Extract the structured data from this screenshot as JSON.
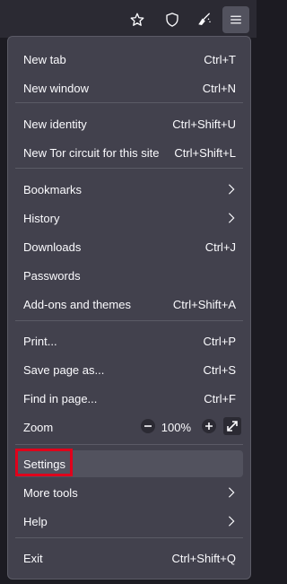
{
  "toolbar": {
    "icons": [
      "star-icon",
      "shield-icon",
      "broom-icon",
      "hamburger-menu-icon"
    ]
  },
  "menu": {
    "new_tab": {
      "label": "New tab",
      "shortcut": "Ctrl+T"
    },
    "new_window": {
      "label": "New window",
      "shortcut": "Ctrl+N"
    },
    "new_identity": {
      "label": "New identity",
      "shortcut": "Ctrl+Shift+U"
    },
    "new_tor_circuit": {
      "label": "New Tor circuit for this site",
      "shortcut": "Ctrl+Shift+L"
    },
    "bookmarks": {
      "label": "Bookmarks"
    },
    "history": {
      "label": "History"
    },
    "downloads": {
      "label": "Downloads",
      "shortcut": "Ctrl+J"
    },
    "passwords": {
      "label": "Passwords"
    },
    "addons": {
      "label": "Add-ons and themes",
      "shortcut": "Ctrl+Shift+A"
    },
    "print": {
      "label": "Print...",
      "shortcut": "Ctrl+P"
    },
    "save_page": {
      "label": "Save page as...",
      "shortcut": "Ctrl+S"
    },
    "find": {
      "label": "Find in page...",
      "shortcut": "Ctrl+F"
    },
    "zoom": {
      "label": "Zoom",
      "value": "100%"
    },
    "settings": {
      "label": "Settings"
    },
    "more_tools": {
      "label": "More tools"
    },
    "help": {
      "label": "Help"
    },
    "exit": {
      "label": "Exit",
      "shortcut": "Ctrl+Shift+Q"
    }
  },
  "colors": {
    "menu_bg": "#42414d",
    "toolbar_bg": "#2b2a33",
    "highlight_outline": "#e0001b"
  }
}
